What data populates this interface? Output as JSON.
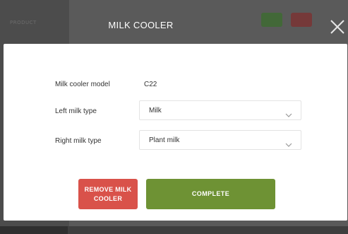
{
  "header": {
    "title": "MILK COOLER",
    "faint_label": "PRODUCT"
  },
  "form": {
    "model": {
      "label": "Milk cooler model",
      "value": "C22"
    },
    "left_milk": {
      "label": "Left milk type",
      "value": "Milk"
    },
    "right_milk": {
      "label": "Right milk type",
      "value": "Plant milk"
    }
  },
  "buttons": {
    "remove": "REMOVE MILK COOLER",
    "complete": "COMPLETE"
  },
  "icons": {
    "close": "close-icon",
    "chevron": "chevron-down-icon"
  },
  "colors": {
    "remove_button": "#d9524a",
    "complete_button": "#6e9234",
    "status_green": "#3e6b33",
    "status_red": "#7a3434"
  }
}
